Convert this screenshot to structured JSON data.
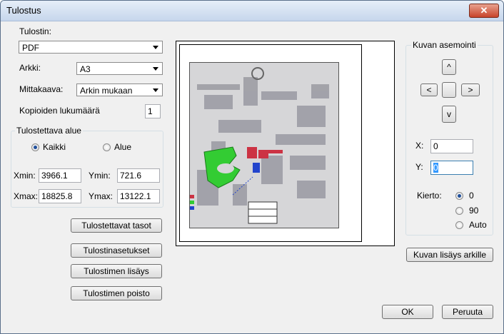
{
  "window": {
    "title": "Tulostus"
  },
  "printer": {
    "label": "Tulostin:",
    "value": "PDF"
  },
  "sheet": {
    "label": "Arkki:",
    "value": "A3"
  },
  "scale": {
    "label": "Mittakaava:",
    "value": "Arkin mukaan"
  },
  "copies": {
    "label": "Kopioiden lukumäärä",
    "value": "1"
  },
  "print_area": {
    "title": "Tulostettava alue",
    "all_label": "Kaikki",
    "area_label": "Alue",
    "selected": "Kaikki",
    "xmin_label": "Xmin:",
    "xmin": "3966.1",
    "ymin_label": "Ymin:",
    "ymin": "721.6",
    "xmax_label": "Xmax:",
    "xmax": "18825.8",
    "ymax_label": "Ymax:",
    "ymax": "13122.1"
  },
  "buttons": {
    "layers": "Tulostettavat tasot",
    "settings": "Tulostinasetukset",
    "add_printer": "Tulostimen lisäys",
    "remove_printer": "Tulostimen poisto",
    "add_to_sheet": "Kuvan lisäys arkille",
    "ok": "OK",
    "cancel": "Peruuta"
  },
  "positioning": {
    "title": "Kuvan asemointi",
    "up": "^",
    "left": "<",
    "right": ">",
    "down": "v",
    "x_label": "X:",
    "x_value": "0",
    "y_label": "Y:",
    "y_value": "0",
    "rotation_label": "Kierto:",
    "rotation_options": [
      "0",
      "90",
      "Auto"
    ],
    "rotation_selected": "0"
  },
  "colors": {
    "green": "#33cc33",
    "red": "#cc3344",
    "blue": "#2244cc",
    "accent": "#1f4f9b"
  }
}
